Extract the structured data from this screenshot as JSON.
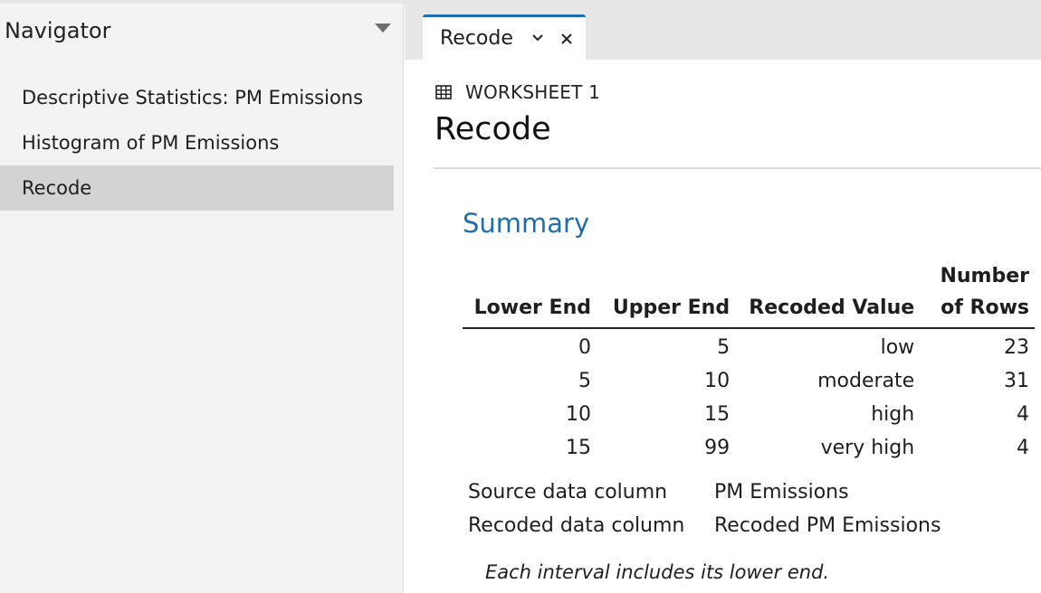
{
  "navigator": {
    "title": "Navigator",
    "items": [
      {
        "label": "Descriptive Statistics: PM Emissions",
        "selected": false
      },
      {
        "label": "Histogram of PM Emissions",
        "selected": false
      },
      {
        "label": "Recode",
        "selected": true
      }
    ]
  },
  "tabs": [
    {
      "label": "Recode",
      "active": true
    }
  ],
  "tab_icons": {
    "menu": "chevron-down-icon",
    "close": "close-icon"
  },
  "content": {
    "worksheet_label": "WORKSHEET 1",
    "title": "Recode",
    "section_title": "Summary",
    "table": {
      "headers": [
        "Lower End",
        "Upper End",
        "Recoded Value",
        "Number\nof Rows"
      ],
      "header_lines": {
        "number_of_rows_line1": "Number",
        "number_of_rows_line2": "of Rows"
      },
      "rows": [
        [
          "0",
          "5",
          "low",
          "23"
        ],
        [
          "5",
          "10",
          "moderate",
          "31"
        ],
        [
          "10",
          "15",
          "high",
          "4"
        ],
        [
          "15",
          "99",
          "very high",
          "4"
        ]
      ]
    },
    "info": [
      {
        "key": "Source data column",
        "value": "PM Emissions"
      },
      {
        "key": "Recoded data column",
        "value": "Recoded PM Emissions"
      }
    ],
    "note": "Each interval includes its lower end."
  },
  "colors": {
    "accent": "#1f6fb0",
    "nav_bg": "#f3f3f3",
    "nav_selected": "#d3d3d3",
    "tabbar_bg": "#e7e7e7"
  }
}
